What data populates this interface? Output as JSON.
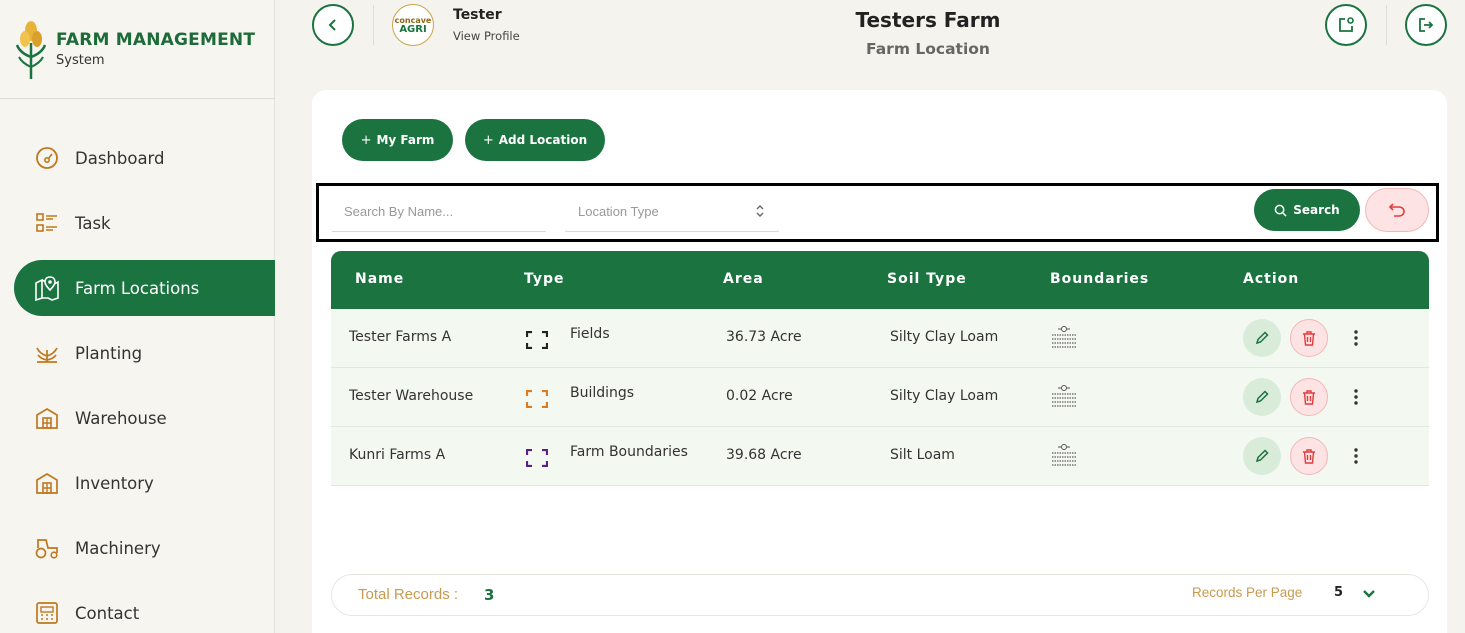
{
  "brand": {
    "title": "FARM MANAGEMENT",
    "subtitle": "System"
  },
  "sidebar": {
    "items": [
      {
        "label": "Dashboard",
        "icon": "dashboard-icon"
      },
      {
        "label": "Task",
        "icon": "task-icon"
      },
      {
        "label": "Farm Locations",
        "icon": "map-pin-icon",
        "active": true
      },
      {
        "label": "Planting",
        "icon": "plant-icon"
      },
      {
        "label": "Warehouse",
        "icon": "warehouse-icon"
      },
      {
        "label": "Inventory",
        "icon": "inventory-icon"
      },
      {
        "label": "Machinery",
        "icon": "tractor-icon"
      },
      {
        "label": "Contact",
        "icon": "contact-icon"
      }
    ]
  },
  "header": {
    "user_name": "Tester",
    "view_profile": "View Profile",
    "avatar_text_top": "concave",
    "avatar_text_bottom": "AGRI",
    "title": "Testers Farm",
    "subtitle": "Farm Location"
  },
  "toolbar": {
    "my_farm_label": "My Farm",
    "add_location_label": "Add Location"
  },
  "filters": {
    "search_placeholder": "Search By Name...",
    "location_type_placeholder": "Location Type",
    "search_label": "Search"
  },
  "table": {
    "columns": [
      "Name",
      "Type",
      "Area",
      "Soil Type",
      "Boundaries",
      "Action"
    ],
    "rows": [
      {
        "name": "Tester Farms A",
        "type": "Fields",
        "type_color": "#222222",
        "area": "36.73 Acre",
        "soil": "Silty Clay Loam"
      },
      {
        "name": "Tester Warehouse",
        "type": "Buildings",
        "type_color": "#e07a1f",
        "area": "0.02 Acre",
        "soil": "Silty Clay Loam"
      },
      {
        "name": "Kunri Farms A",
        "type": "Farm Boundaries",
        "type_color": "#5b1f8a",
        "area": "39.68 Acre",
        "soil": "Silt Loam"
      }
    ]
  },
  "footer": {
    "total_label": "Total Records :",
    "total_value": "3",
    "records_per_page_label": "Records Per Page",
    "records_per_page_value": "5"
  },
  "colors": {
    "primary": "#1b7340",
    "danger": "#e23c3c",
    "accent": "#c89a4e"
  }
}
